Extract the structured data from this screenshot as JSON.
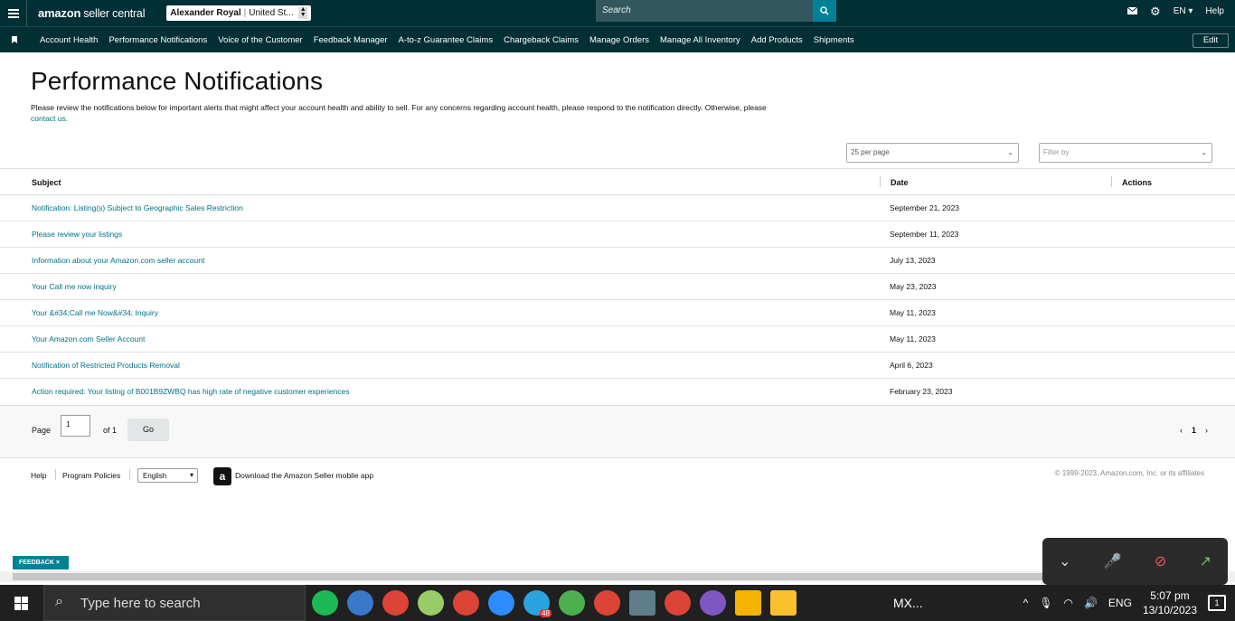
{
  "header": {
    "logo_main": "amazon",
    "logo_sub": "seller central",
    "account_name": "Alexander Royal",
    "account_region": "United St...",
    "search_placeholder": "Search",
    "language": "EN",
    "help": "Help"
  },
  "nav": {
    "items": [
      "Account Health",
      "Performance Notifications",
      "Voice of the Customer",
      "Feedback Manager",
      "A-to-z Guarantee Claims",
      "Chargeback Claims",
      "Manage Orders",
      "Manage All Inventory",
      "Add Products",
      "Shipments"
    ],
    "edit": "Edit"
  },
  "page": {
    "title": "Performance Notifications",
    "intro": "Please review the notifications below for important alerts that might affect your account health and ability to sell. For any concerns regarding account health, please respond to the notification directly. Otherwise, please",
    "contact_link": "contact us.",
    "per_page": "25 per page",
    "filter_placeholder": "Filter by"
  },
  "table": {
    "headers": {
      "subject": "Subject",
      "date": "Date",
      "actions": "Actions"
    },
    "rows": [
      {
        "subject": "Notification: Listing(s) Subject to Geographic Sales Restriction",
        "date": "September 21, 2023"
      },
      {
        "subject": "Please review your listings",
        "date": "September 11, 2023"
      },
      {
        "subject": "Information about your Amazon.com seller account",
        "date": "July 13, 2023"
      },
      {
        "subject": "Your Call me now inquiry",
        "date": "May 23, 2023"
      },
      {
        "subject": "Your &#34;Call me Now&#34; Inquiry",
        "date": "May 11, 2023"
      },
      {
        "subject": "Your Amazon.com Seller Account",
        "date": "May 11, 2023"
      },
      {
        "subject": "Notification of Restricted Products Removal",
        "date": "April 6, 2023"
      },
      {
        "subject": "Action required: Your listing of B001B9ZWBQ has high rate of negative customer experiences",
        "date": "February 23, 2023"
      }
    ]
  },
  "pager": {
    "page_label": "Page",
    "page_value": "1",
    "of_label": "of 1",
    "go": "Go",
    "current": "1"
  },
  "footer": {
    "help": "Help",
    "policies": "Program Policies",
    "language": "English",
    "app_icon": "a",
    "app_text": "Download the Amazon Seller mobile app",
    "copyright": "© 1999-2023, Amazon.com, Inc. or its affiliates"
  },
  "feedback": "FEEDBACK ×",
  "taskbar": {
    "search_placeholder": "Type here to search",
    "app_label": "MX...",
    "telegram_badge": "48",
    "lang": "ENG",
    "time": "5:07 pm",
    "date": "13/10/2023",
    "notif_count": "1"
  }
}
